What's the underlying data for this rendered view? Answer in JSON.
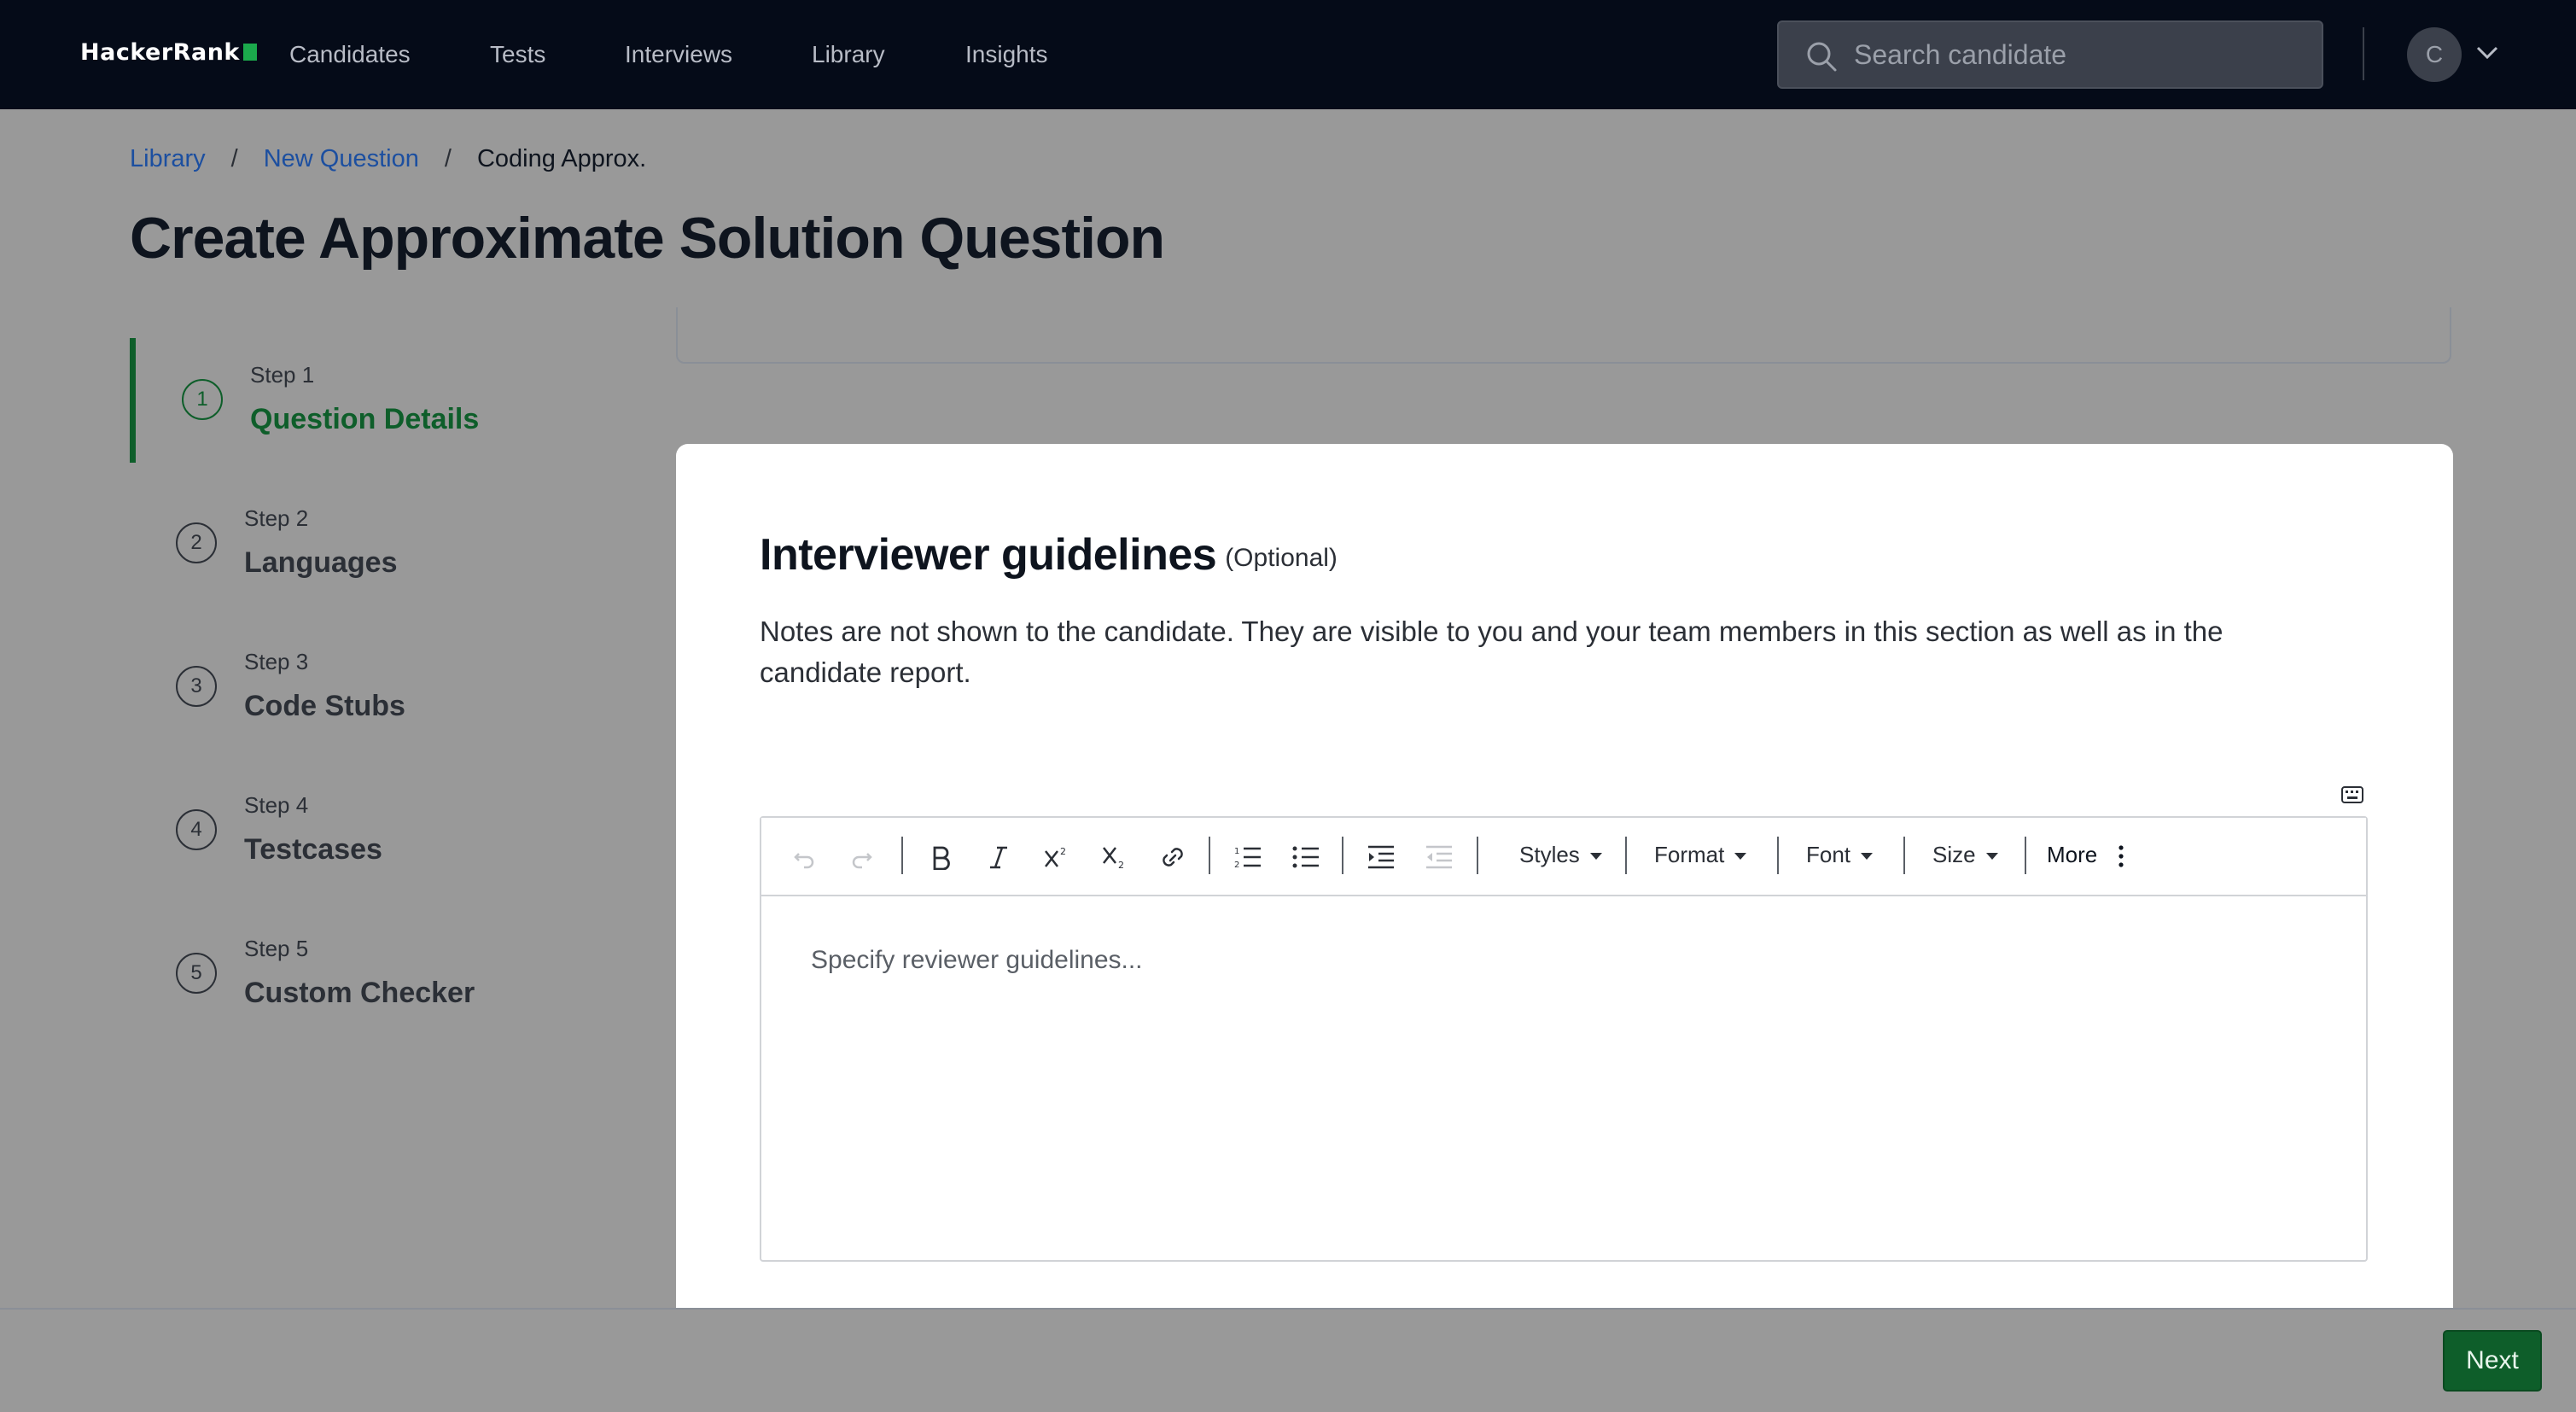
{
  "nav": {
    "logo": "HackerRank",
    "links": [
      "Candidates",
      "Tests",
      "Interviews",
      "Library",
      "Insights"
    ],
    "search_placeholder": "Search candidate",
    "avatar_initial": "C"
  },
  "breadcrumb": {
    "items": [
      "Library",
      "New Question",
      "Coding Approx."
    ],
    "separator": "/"
  },
  "page_title": "Create Approximate Solution Question",
  "steps": [
    {
      "kicker": "Step 1",
      "name": "Question Details",
      "number": "1",
      "active": true
    },
    {
      "kicker": "Step 2",
      "name": "Languages",
      "number": "2",
      "active": false
    },
    {
      "kicker": "Step 3",
      "name": "Code Stubs",
      "number": "3",
      "active": false
    },
    {
      "kicker": "Step 4",
      "name": "Testcases",
      "number": "4",
      "active": false
    },
    {
      "kicker": "Step 5",
      "name": "Custom Checker",
      "number": "5",
      "active": false
    }
  ],
  "modal": {
    "title": "Interviewer guidelines",
    "optional": "(Optional)",
    "description": "Notes are not shown to the candidate. They are visible to you and your team members in this section as well as in the candidate report.",
    "editor_placeholder": "Specify reviewer guidelines...",
    "toolbar": {
      "styles": "Styles",
      "format": "Format",
      "font": "Font",
      "size": "Size",
      "more": "More"
    }
  },
  "footer": {
    "next_label": "Next"
  },
  "colors": {
    "nav_bg": "#050b18",
    "accent_green": "#0e5e2a",
    "link_blue": "#1c4fa0",
    "overlay": "#999999"
  }
}
